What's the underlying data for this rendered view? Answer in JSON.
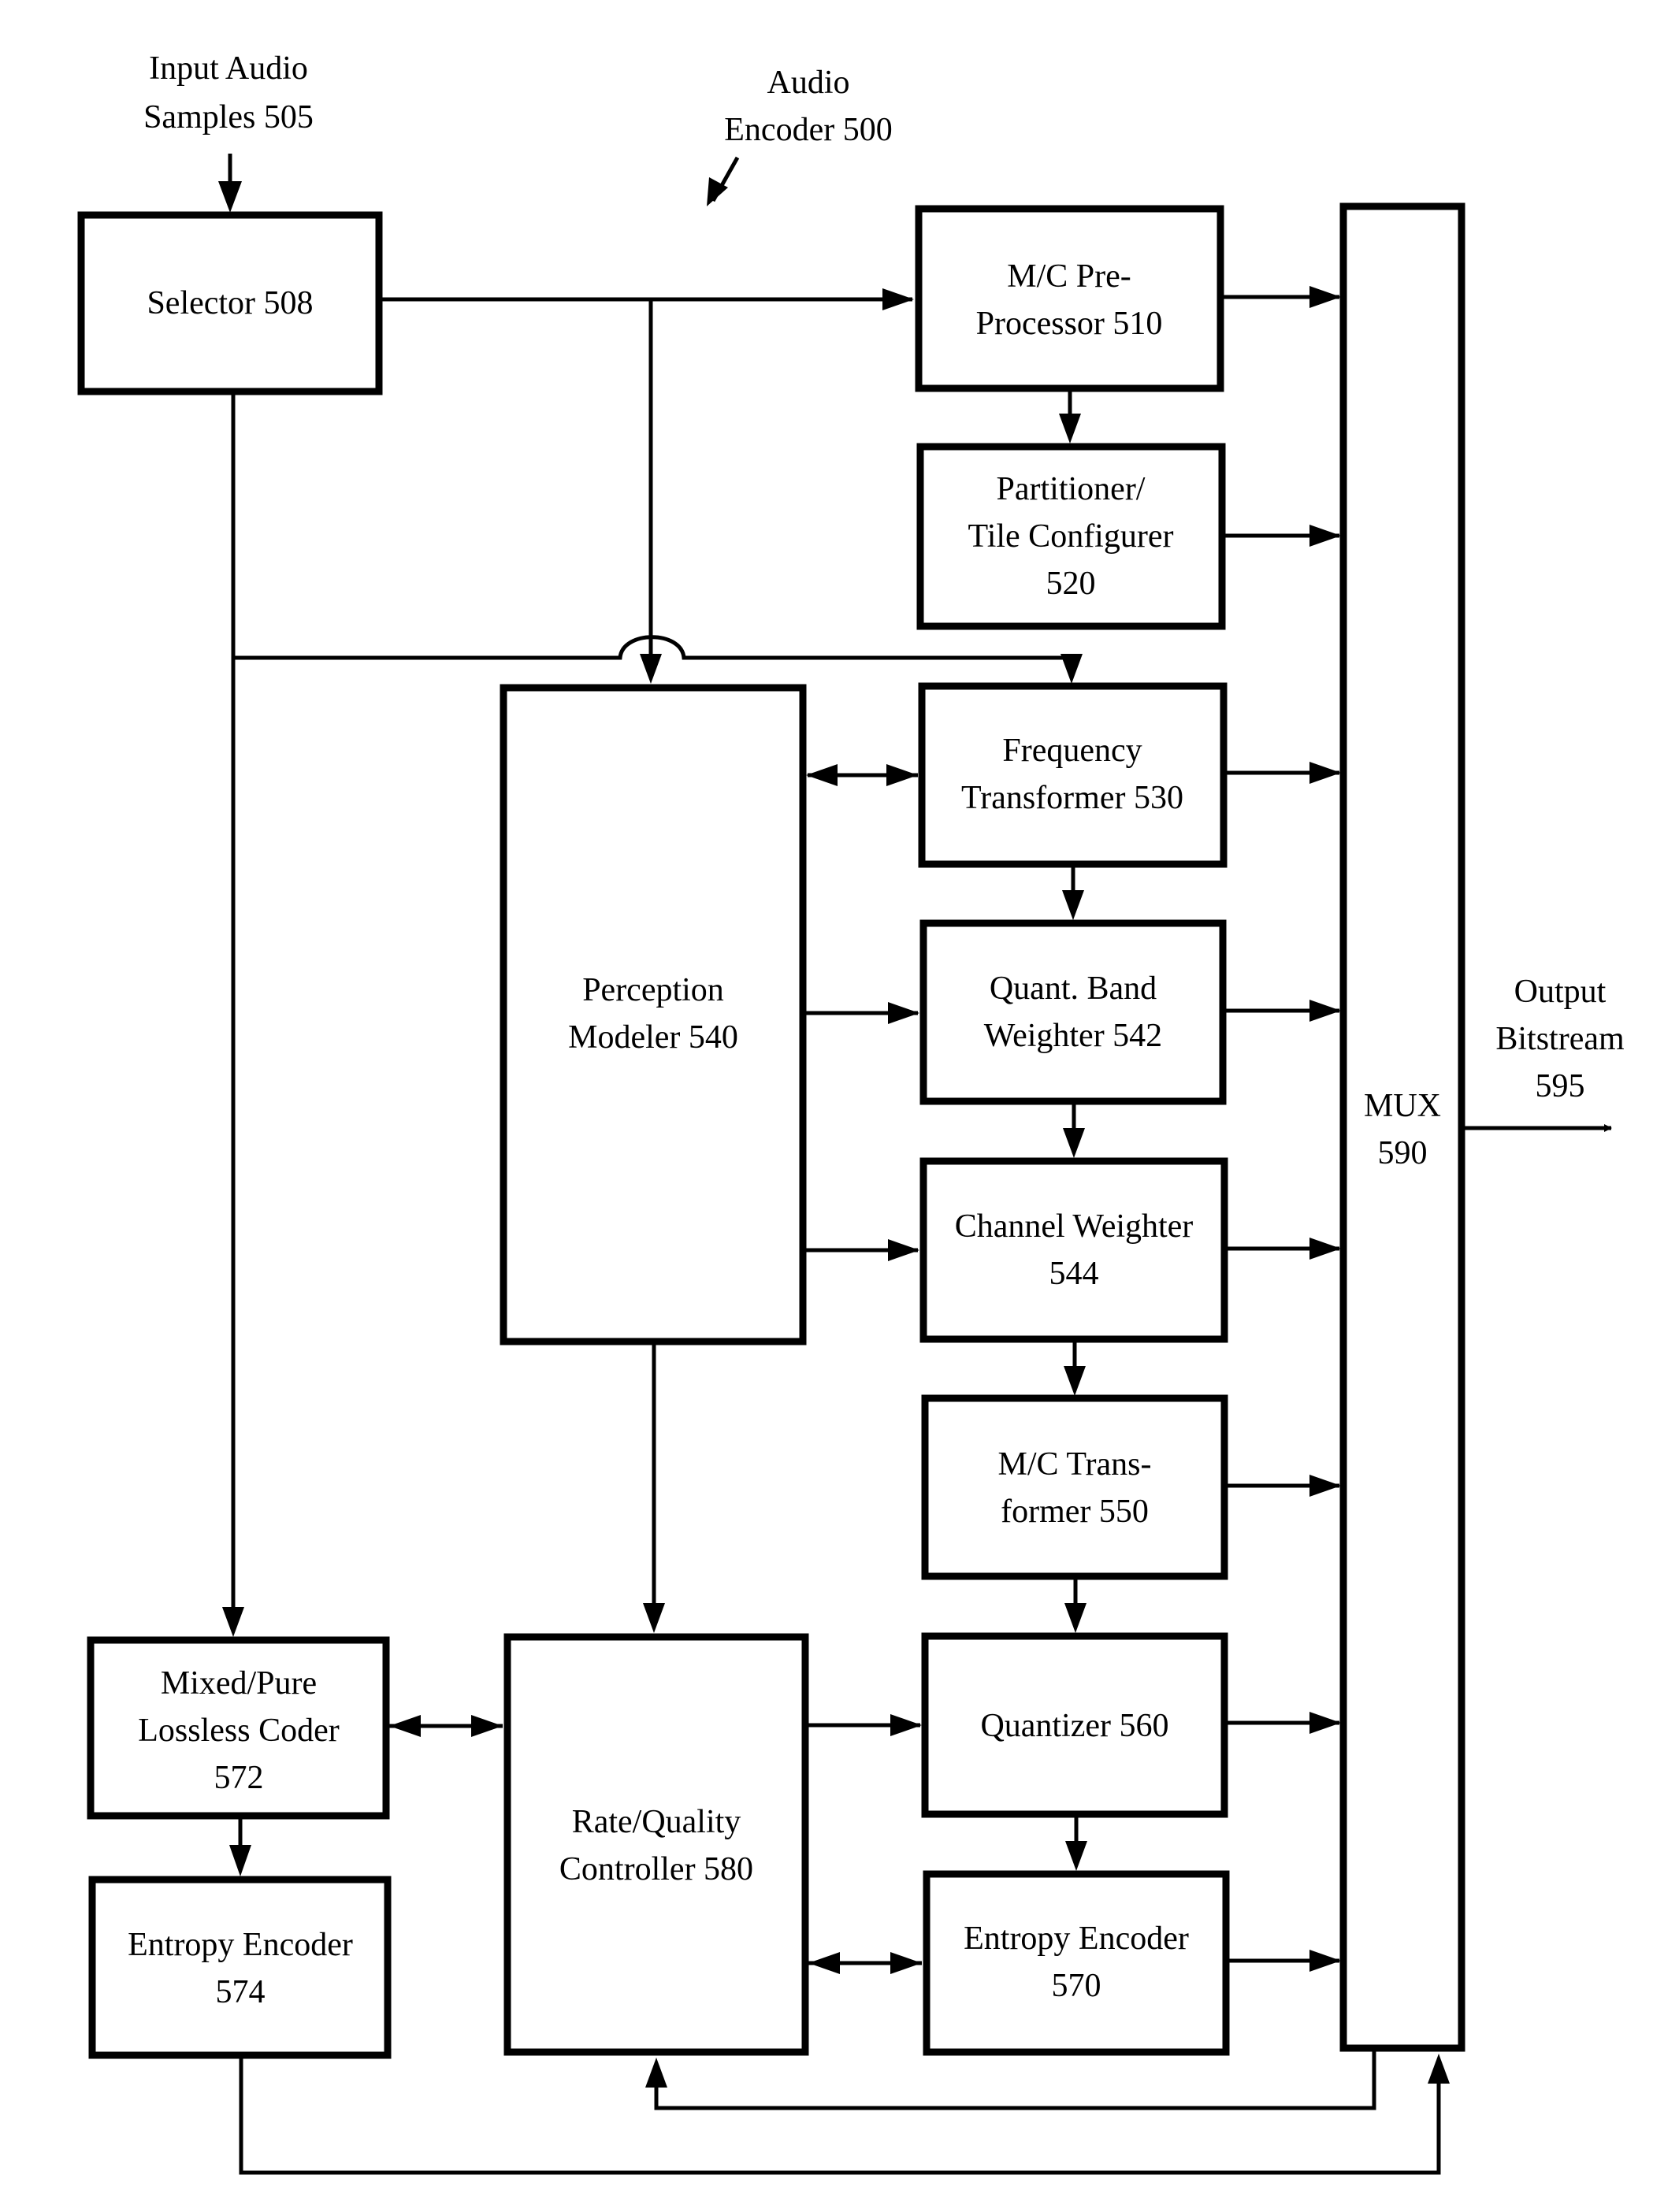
{
  "title": {
    "line1": "Audio",
    "line2": "Encoder 500"
  },
  "input": {
    "line1": "Input Audio",
    "line2": "Samples 505"
  },
  "output": {
    "line1": "Output",
    "line2": "Bitstream",
    "line3": "595"
  },
  "blocks": {
    "selector": {
      "line1": "Selector 508"
    },
    "mc_pre": {
      "line1": "M/C Pre-",
      "line2": "Processor 510"
    },
    "partitioner": {
      "line1": "Partitioner/",
      "line2": "Tile Configurer",
      "line3": "520"
    },
    "freq": {
      "line1": "Frequency",
      "line2": "Transformer 530"
    },
    "perception": {
      "line1": "Perception",
      "line2": "Modeler 540"
    },
    "qbw": {
      "line1": "Quant. Band",
      "line2": "Weighter 542"
    },
    "chw": {
      "line1": "Channel Weighter",
      "line2": "544"
    },
    "mct": {
      "line1": "M/C Trans-",
      "line2": "former 550"
    },
    "quant": {
      "line1": "Quantizer 560"
    },
    "ent570": {
      "line1": "Entropy Encoder",
      "line2": "570"
    },
    "lossless": {
      "line1": "Mixed/Pure",
      "line2": "Lossless Coder",
      "line3": "572"
    },
    "ent574": {
      "line1": "Entropy Encoder",
      "line2": "574"
    },
    "rate": {
      "line1": "Rate/Quality",
      "line2": "Controller 580"
    },
    "mux": {
      "line1": "MUX",
      "line2": "590"
    }
  }
}
